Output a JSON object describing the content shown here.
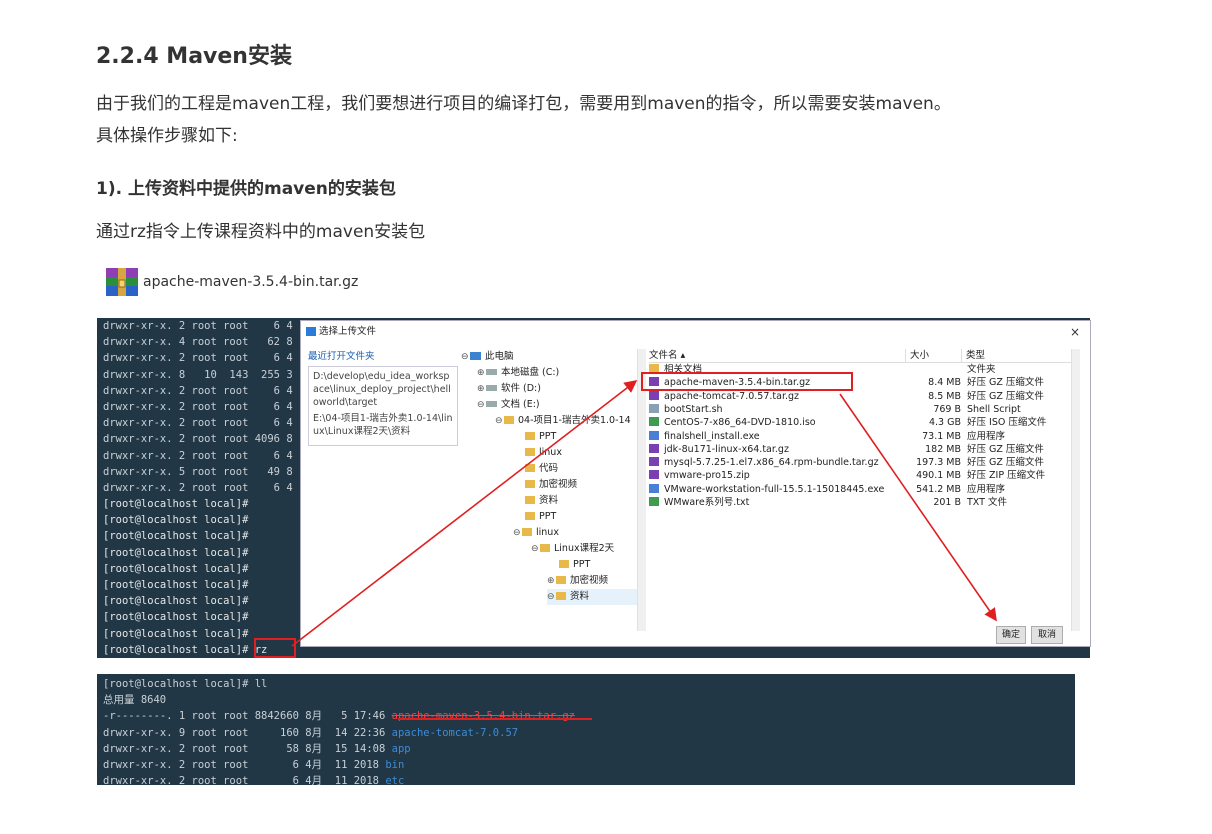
{
  "section": {
    "title": "2.2.4 Maven安装",
    "intro_line1": "由于我们的工程是maven工程，我们要想进行项目的编译打包，需要用到maven的指令，所以需要安装maven。",
    "intro_line2": "具体操作步骤如下:",
    "step1_heading": "1). 上传资料中提供的maven的安装包",
    "step1_text": "通过rz指令上传课程资料中的maven安装包",
    "package_filename": "apache-maven-3.5.4-bin.tar.gz"
  },
  "terminal1": {
    "lines": [
      "drwxr-xr-x. 2 root root    6 4",
      "drwxr-xr-x. 4 root root   62 8",
      "drwxr-xr-x. 2 root root    6 4",
      "drwxr-xr-x. 8   10  143  255 3",
      "drwxr-xr-x. 2 root root    6 4",
      "drwxr-xr-x. 2 root root    6 4",
      "drwxr-xr-x. 2 root root    6 4",
      "drwxr-xr-x. 2 root root 4096 8",
      "drwxr-xr-x. 2 root root    6 4",
      "drwxr-xr-x. 5 root root   49 8",
      "drwxr-xr-x. 2 root root    6 4",
      "[root@localhost local]#",
      "[root@localhost local]#",
      "[root@localhost local]#",
      "[root@localhost local]#",
      "[root@localhost local]#",
      "[root@localhost local]#",
      "[root@localhost local]#",
      "[root@localhost local]#",
      "[root@localhost local]#",
      "[root@localhost local]# rz"
    ],
    "rz_command": "rz"
  },
  "dialog": {
    "title": "选择上传文件",
    "close": "×",
    "recent_label": "最近打开文件夹",
    "recent_path1": "D:\\develop\\edu_idea_workspace\\linux_deploy_project\\helloworld\\target",
    "recent_path2": "E:\\04-项目1-瑞吉外卖1.0-14\\linux\\Linux课程2天\\资料",
    "tree": {
      "this_pc": "此电脑",
      "drive_c": "本地磁盘 (C:)",
      "drive_d": "软件 (D:)",
      "drive_e": "文档 (E:)",
      "project": "04-项目1-瑞吉外卖1.0-14",
      "ppt1": "PPT",
      "linux1": "linux",
      "code": "代码",
      "enc_video1": "加密视频",
      "docs1": "资料",
      "ppt2": "PPT",
      "linux2": "linux",
      "linux_course": "Linux课程2天",
      "ppt3": "PPT",
      "enc_video2": "加密视频",
      "docs2": "资料"
    },
    "columns": {
      "name": "文件名",
      "size": "大小",
      "type": "类型"
    },
    "files": [
      {
        "name": "相关文档",
        "size": "",
        "type": "文件夹"
      },
      {
        "name": "apache-maven-3.5.4-bin.tar.gz",
        "size": "8.4 MB",
        "type": "好压 GZ 压缩文件"
      },
      {
        "name": "apache-tomcat-7.0.57.tar.gz",
        "size": "8.5 MB",
        "type": "好压 GZ 压缩文件"
      },
      {
        "name": "bootStart.sh",
        "size": "769 B",
        "type": "Shell Script"
      },
      {
        "name": "CentOS-7-x86_64-DVD-1810.iso",
        "size": "4.3 GB",
        "type": "好压 ISO 压缩文件"
      },
      {
        "name": "finalshell_install.exe",
        "size": "73.1 MB",
        "type": "应用程序"
      },
      {
        "name": "jdk-8u171-linux-x64.tar.gz",
        "size": "182 MB",
        "type": "好压 GZ 压缩文件"
      },
      {
        "name": "mysql-5.7.25-1.el7.x86_64.rpm-bundle.tar.gz",
        "size": "197.3 MB",
        "type": "好压 GZ 压缩文件"
      },
      {
        "name": "vmware-pro15.zip",
        "size": "490.1 MB",
        "type": "好压 ZIP 压缩文件"
      },
      {
        "name": "VMware-workstation-full-15.5.1-15018445.exe",
        "size": "541.2 MB",
        "type": "应用程序"
      },
      {
        "name": "WMware系列号.txt",
        "size": "201 B",
        "type": "TXT 文件"
      }
    ],
    "ok_label": "确定",
    "cancel_label": "取消"
  },
  "terminal2": {
    "lines": [
      {
        "prefix": "[root@localhost local]# ll",
        "name": "",
        "kind": ""
      },
      {
        "prefix": "总用量 8640",
        "name": "",
        "kind": ""
      },
      {
        "prefix": "-r--------. 1 root root 8842660 8月   5 17:46 ",
        "name": "apache-maven-3.5.4-bin.tar.gz",
        "kind": "red"
      },
      {
        "prefix": "drwxr-xr-x. 9 root root     160 8月  14 22:36 ",
        "name": "apache-tomcat-7.0.57",
        "kind": "blue"
      },
      {
        "prefix": "drwxr-xr-x. 2 root root      58 8月  15 14:08 ",
        "name": "app",
        "kind": "blue"
      },
      {
        "prefix": "drwxr-xr-x. 2 root root       6 4月  11 2018 ",
        "name": "bin",
        "kind": "blue"
      },
      {
        "prefix": "drwxr-xr-x. 2 root root       6 4月  11 2018 ",
        "name": "etc",
        "kind": "blue"
      }
    ]
  }
}
